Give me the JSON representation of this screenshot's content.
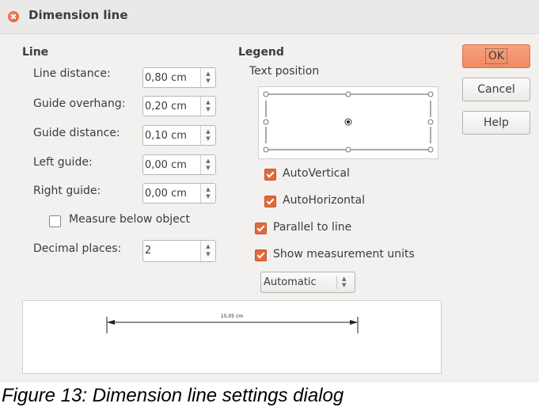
{
  "window": {
    "title": "Dimension line"
  },
  "line_section": {
    "heading": "Line",
    "fields": [
      {
        "label": "Line distance:",
        "value": "0,80 cm"
      },
      {
        "label": "Guide overhang:",
        "value": "0,20 cm"
      },
      {
        "label": "Guide distance:",
        "value": "0,10 cm"
      },
      {
        "label": "Left guide:",
        "value": "0,00 cm"
      },
      {
        "label": "Right guide:",
        "value": "0,00 cm"
      }
    ],
    "measure_below": {
      "label": "Measure below object",
      "checked": false
    },
    "decimal_places": {
      "label": "Decimal places:",
      "value": "2"
    }
  },
  "legend_section": {
    "heading": "Legend",
    "text_position_label": "Text position",
    "auto_vertical": {
      "label": "AutoVertical",
      "checked": true
    },
    "auto_horizontal": {
      "label": "AutoHorizontal",
      "checked": true
    },
    "parallel": {
      "label": "Parallel to line",
      "checked": true
    },
    "show_units": {
      "label": "Show measurement units",
      "checked": true
    },
    "units_combo": {
      "value": "Automatic"
    }
  },
  "buttons": {
    "ok": "OK",
    "cancel": "Cancel",
    "help": "Help"
  },
  "preview": {
    "measurement": "15,05 cm"
  },
  "caption": "Figure 13: Dimension line settings dialog",
  "colors": {
    "accent": "#e0693e",
    "ok_button": "#f29470",
    "dialog_bg": "#f2f1f0"
  }
}
